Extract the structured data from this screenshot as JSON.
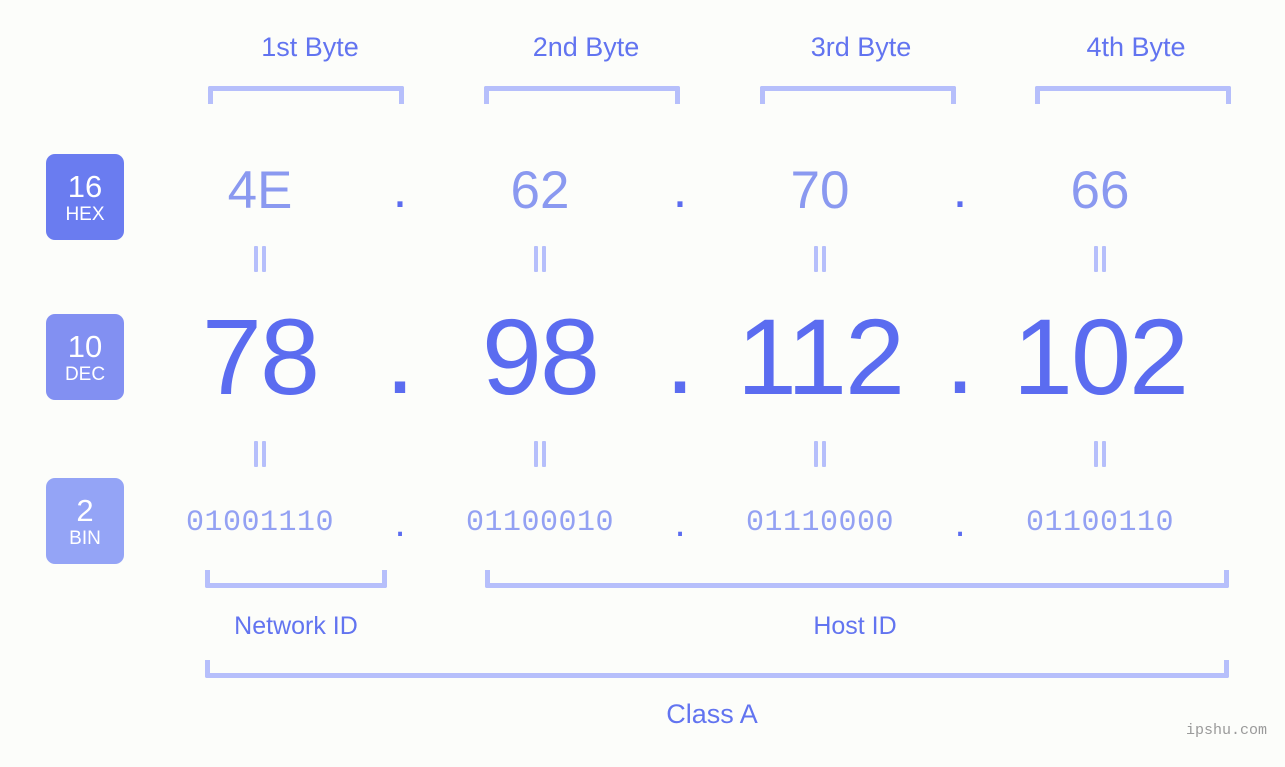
{
  "background_color": "#fcfdfa",
  "accent_colors": {
    "bracket": "#b6bffb",
    "label": "#6274f0",
    "hex_value": "#8a99f0",
    "dec_value": "#5b6cf0",
    "bin_value": "#93a1f3",
    "badge_hex": "#6a7cf0",
    "badge_dec": "#8290f2",
    "badge_bin": "#94a4f6"
  },
  "byte_headers": [
    {
      "label": "1st Byte"
    },
    {
      "label": "2nd Byte"
    },
    {
      "label": "3rd Byte"
    },
    {
      "label": "4th Byte"
    }
  ],
  "bases": [
    {
      "number": "16",
      "abbr": "HEX"
    },
    {
      "number": "10",
      "abbr": "DEC"
    },
    {
      "number": "2",
      "abbr": "BIN"
    }
  ],
  "rows": {
    "hex": {
      "base_number": "16",
      "base_abbr": "HEX",
      "values": [
        "4E",
        "62",
        "70",
        "66"
      ],
      "separator": "."
    },
    "dec": {
      "base_number": "10",
      "base_abbr": "DEC",
      "values": [
        "78",
        "98",
        "112",
        "102"
      ],
      "separator": "."
    },
    "bin": {
      "base_number": "2",
      "base_abbr": "BIN",
      "values": [
        "01001110",
        "01100010",
        "01110000",
        "01100110"
      ],
      "separator": "."
    }
  },
  "equals_symbol": "=",
  "segments": [
    {
      "name": "network-id",
      "label": "Network ID"
    },
    {
      "name": "host-id",
      "label": "Host ID"
    }
  ],
  "class_label": "Class A",
  "watermark": "ipshu.com"
}
